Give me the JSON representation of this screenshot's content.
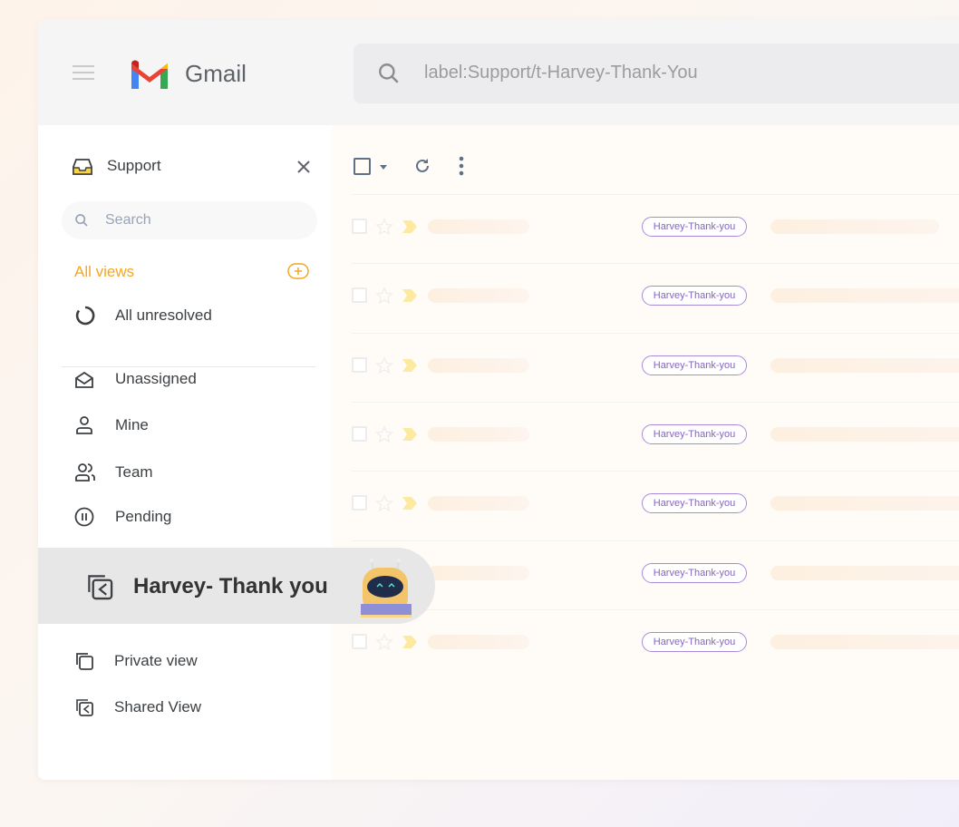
{
  "header": {
    "brand": "Gmail",
    "search_value": "label:Support/t-Harvey-Thank-You"
  },
  "sidebar": {
    "title": "Support",
    "search_placeholder": "Search",
    "section_label": "All views",
    "all_unresolved": "All unresolved",
    "items": [
      {
        "label": "Unassigned",
        "icon": "envelope-open-icon"
      },
      {
        "label": "Mine",
        "icon": "user-icon"
      },
      {
        "label": "Team",
        "icon": "users-icon"
      },
      {
        "label": "Pending",
        "icon": "pause-circle-icon"
      }
    ],
    "selected": "Harvey- Thank you",
    "extra": [
      {
        "label": "Private view",
        "icon": "copy-icon"
      },
      {
        "label": "Shared View",
        "icon": "shared-view-icon"
      }
    ]
  },
  "rows": [
    {
      "tag": "Harvey-Thank-you"
    },
    {
      "tag": "Harvey-Thank-you"
    },
    {
      "tag": "Harvey-Thank-you"
    },
    {
      "tag": "Harvey-Thank-you"
    },
    {
      "tag": "Harvey-Thank-you"
    },
    {
      "tag": "Harvey-Thank-you"
    },
    {
      "tag": "Harvey-Thank-you"
    }
  ],
  "colors": {
    "accent": "#f5a623",
    "tag": "#8464c4",
    "selected_bg": "#e7e7e8"
  }
}
